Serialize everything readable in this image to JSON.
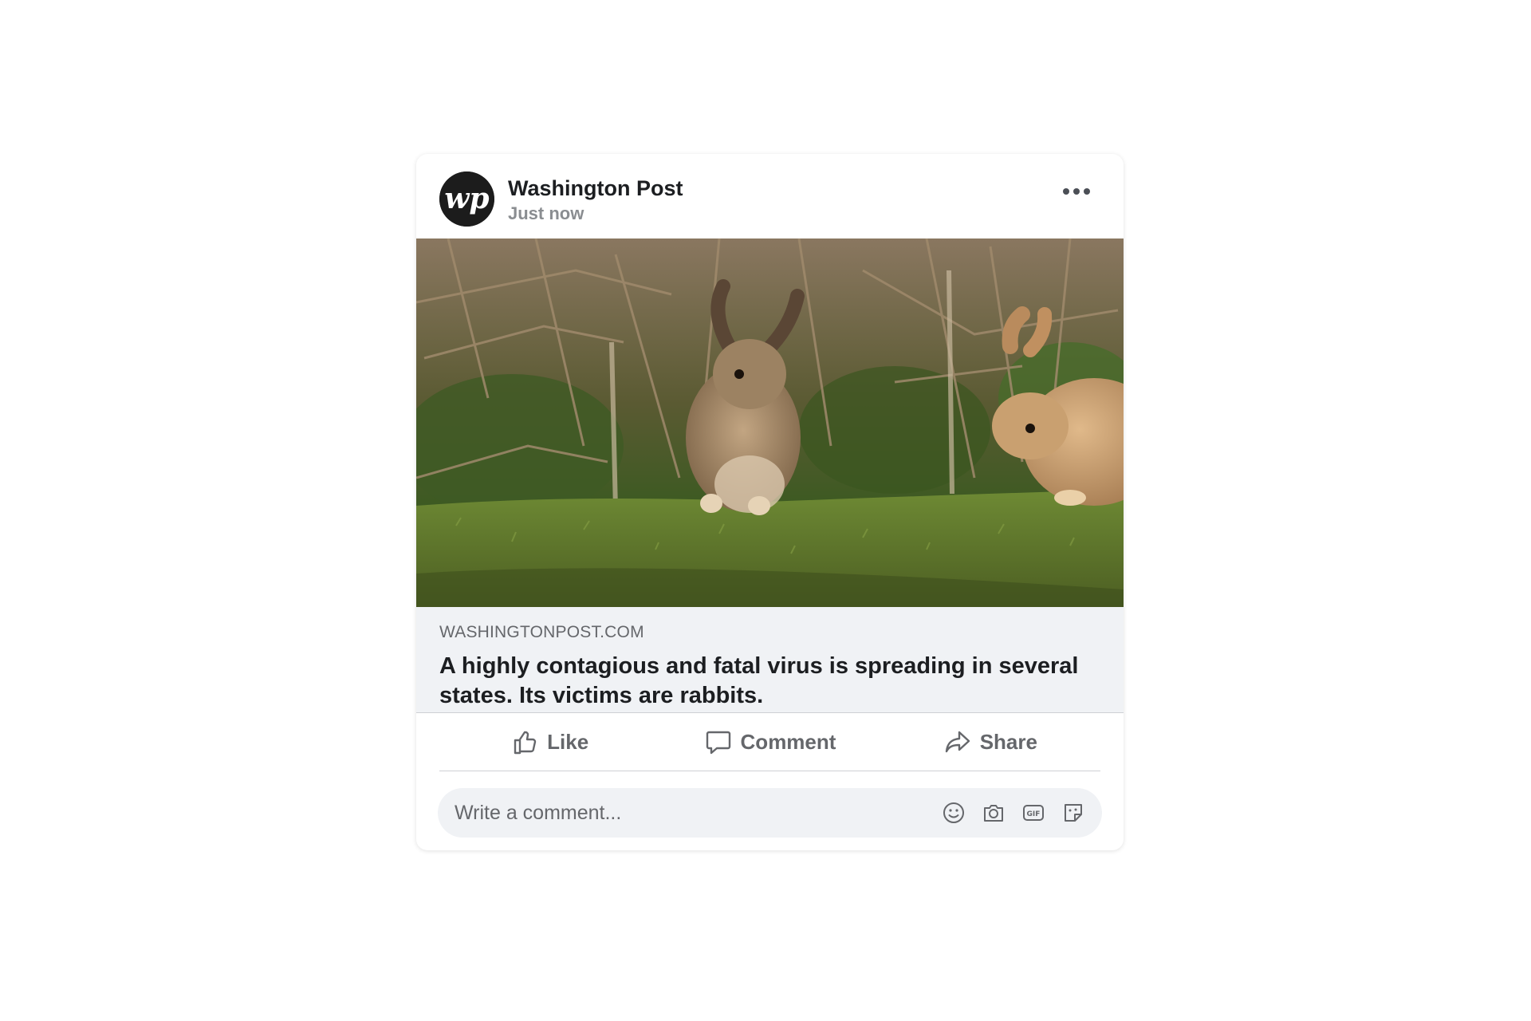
{
  "post": {
    "page_name": "Washington Post",
    "timestamp": "Just now",
    "avatar_letters": "wp",
    "more_icon": "more-horizontal-icon"
  },
  "link_preview": {
    "domain": "WASHINGTONPOST.COM",
    "title": "A highly contagious and fatal virus is spreading in several states. Its victims are rabbits."
  },
  "actions": {
    "like_label": "Like",
    "comment_label": "Comment",
    "share_label": "Share"
  },
  "comment_box": {
    "placeholder": "Write a comment...",
    "tools": [
      "emoji-icon",
      "camera-icon",
      "gif-icon",
      "sticker-icon"
    ]
  },
  "colors": {
    "text_primary": "#1c1e21",
    "text_secondary": "#65676b",
    "preview_bg": "#f0f2f5",
    "avatar_bg": "#1c1c1c"
  }
}
